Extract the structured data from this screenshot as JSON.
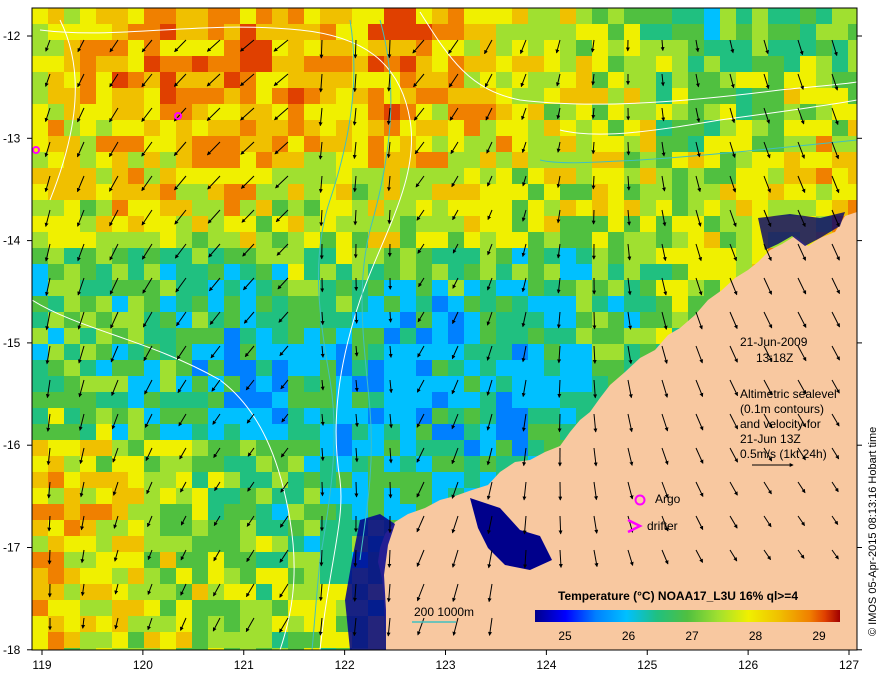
{
  "map": {
    "date": "21-Jun-2009",
    "time": "13:18Z",
    "legend_lines": [
      "Altimetric sealevel",
      "(0.1m contours)",
      "and velocity for",
      "21-Jun 13Z",
      "0.5m/s (1kt 24h)"
    ],
    "argo_label": "Argo",
    "drifter_label": "drifter",
    "depth_label": "200  1000m",
    "credit": "© IMOS 05-Apr-2015 08:13:16 Hobart time",
    "colorbar_title": "Temperature (°C) NOAA17_L3U 16% ql>=4",
    "colorbar_ticks": [
      "25",
      "26",
      "27",
      "28",
      "29"
    ],
    "x_ticks": [
      "119",
      "120",
      "121",
      "122",
      "123",
      "124",
      "125",
      "126",
      "127"
    ],
    "y_ticks": [
      "-12",
      "-13",
      "-14",
      "-15",
      "-16",
      "-17",
      "-18"
    ],
    "colors": {
      "land": "#f8c8a0",
      "argo": "#ff00ff",
      "drifter": "#ff00ff",
      "contour": "#ffffff",
      "depth_contour": "#40c0c0",
      "sst_scale": [
        "#00008b",
        "#0000ff",
        "#0080ff",
        "#00c0ff",
        "#20c080",
        "#50c040",
        "#a0e030",
        "#f0f000",
        "#f0c000",
        "#f08000",
        "#e04000",
        "#a00000"
      ]
    }
  }
}
